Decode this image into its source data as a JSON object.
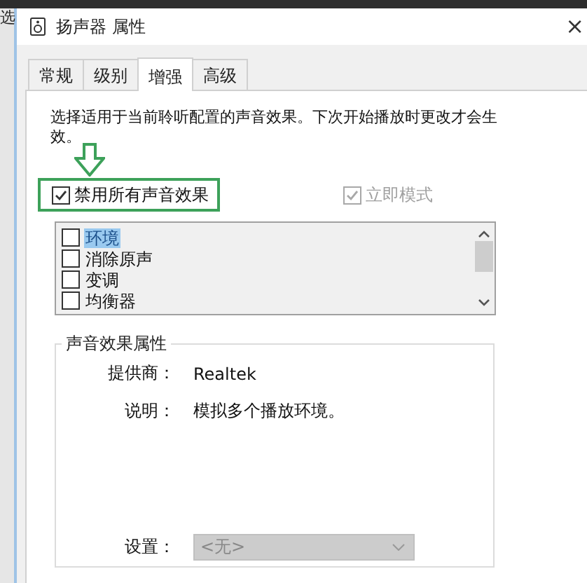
{
  "background_window": {
    "text": "选"
  },
  "window": {
    "title": "扬声器 属性",
    "close": "×"
  },
  "tabs": [
    {
      "label": "常规",
      "selected": false
    },
    {
      "label": "级别",
      "selected": false
    },
    {
      "label": "增强",
      "selected": true
    },
    {
      "label": "高级",
      "selected": false
    }
  ],
  "description": "选择适用于当前聆听配置的声音效果。下次开始播放时更改才会生效。",
  "disable_all": {
    "label": "禁用所有声音效果",
    "checked": true,
    "highlighted": true
  },
  "immediate_mode": {
    "label": "立即模式",
    "checked": true,
    "disabled": true
  },
  "effects": [
    {
      "label": "环境",
      "checked": false,
      "selected": true
    },
    {
      "label": "消除原声",
      "checked": false,
      "selected": false
    },
    {
      "label": "变调",
      "checked": false,
      "selected": false
    },
    {
      "label": "均衡器",
      "checked": false,
      "selected": false
    }
  ],
  "properties": {
    "title": "声音效果属性",
    "provider_label": "提供商：",
    "provider": "Realtek",
    "description_label": "说明：",
    "description": "模拟多个播放环境。",
    "setting_label": "设置：",
    "setting": {
      "value": "<无>",
      "disabled": true
    }
  }
}
